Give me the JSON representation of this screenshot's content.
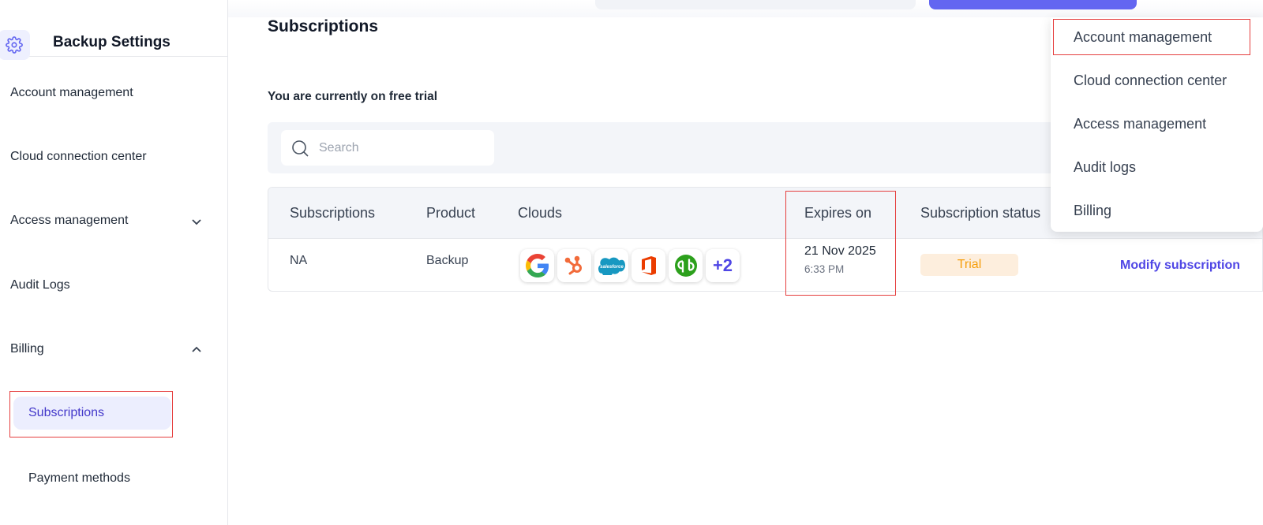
{
  "sidebar": {
    "title": "Backup Settings",
    "items": [
      {
        "label": "Account management"
      },
      {
        "label": "Cloud connection center"
      },
      {
        "label": "Access management"
      },
      {
        "label": "Audit Logs"
      },
      {
        "label": "Billing"
      }
    ],
    "billing_children": [
      {
        "label": "Subscriptions",
        "active": true
      },
      {
        "label": "Payment methods"
      }
    ]
  },
  "main": {
    "title": "Subscriptions",
    "trial_note": "You are currently on free trial",
    "search": {
      "placeholder": "Search"
    },
    "table": {
      "headers": [
        "Subscriptions",
        "Product",
        "Clouds",
        "Expires on",
        "Subscription status"
      ],
      "rows": [
        {
          "subscription": "NA",
          "product": "Backup",
          "clouds": [
            "google-icon",
            "hubspot-icon",
            "salesforce-icon",
            "office365-icon",
            "quickbooks-icon"
          ],
          "clouds_more": "+2",
          "expires_date": "21 Nov 2025",
          "expires_time": "6:33 PM",
          "status": "Trial",
          "action": "Modify subscription"
        }
      ]
    }
  },
  "dropdown": {
    "items": [
      "Account management",
      "Cloud connection center",
      "Access management",
      "Audit logs",
      "Billing"
    ]
  },
  "colors": {
    "accent": "#4f46e5",
    "highlight": "#e53e3e",
    "trial_badge_bg": "#fdeedd",
    "trial_badge_text": "#f59e0b"
  }
}
